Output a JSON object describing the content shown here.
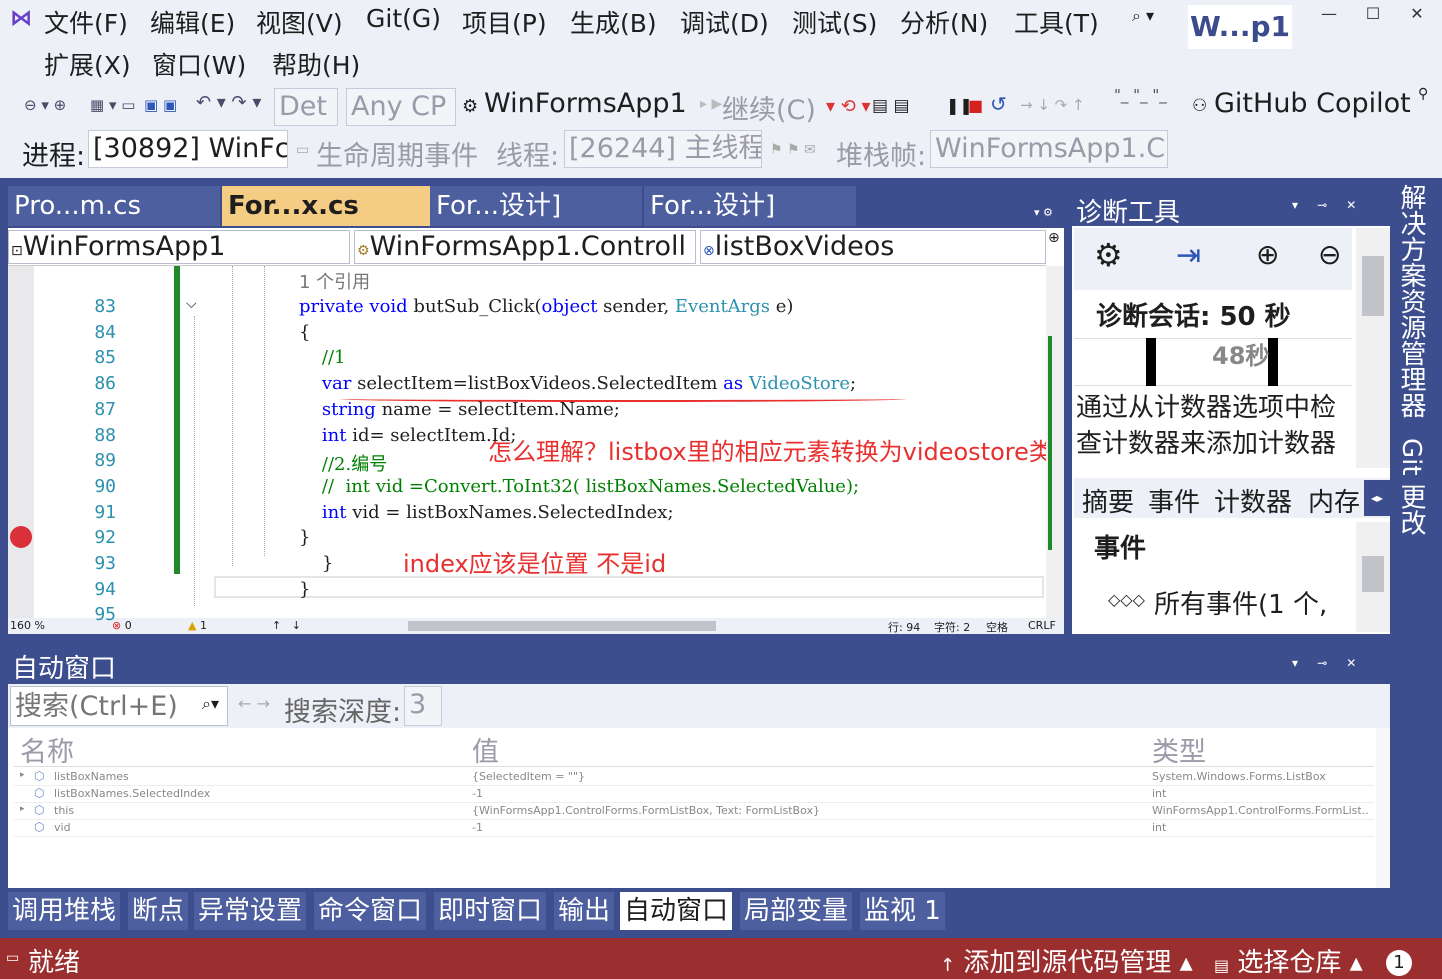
{
  "menu": [
    "文件(F)",
    "编辑(E)",
    "视图(V)",
    "Git(G)",
    "项目(P)",
    "生成(B)",
    "调试(D)",
    "测试(S)",
    "分析(N)",
    "工具(T)",
    "扩展(X)",
    "窗口(W)",
    "帮助(H)"
  ],
  "title_badge": "W...p1",
  "window_controls": {
    "minimize": "—",
    "maximize": "☐",
    "close": "✕"
  },
  "toolbar": {
    "config": "Det",
    "platform": "Any CP",
    "startup_project": "WinFormsApp1",
    "continue": "继续(C)",
    "copilot": "GitHub Copilot"
  },
  "debugbar": {
    "process_label": "进程:",
    "process_value": "[30892] WinFc",
    "lifecycle": "生命周期事件",
    "thread_label": "线程:",
    "thread_value": "[26244] 主线程",
    "stack_label": "堆栈帧:",
    "stack_value": "WinFormsApp1.C"
  },
  "doc_tabs": [
    "Pro...m.cs",
    "For...x.cs",
    "For...设计]",
    "For...设计]"
  ],
  "nav": {
    "project": "WinFormsApp1",
    "class": "WinFormsApp1.Controll",
    "member": "listBoxVideos"
  },
  "code": {
    "refs": "1 个引用",
    "lines": [
      {
        "no": "83",
        "tokens": [
          [
            "kw",
            "private "
          ],
          [
            "kw",
            "void "
          ],
          [
            "pl",
            "butSub_Click("
          ],
          [
            "kw",
            "object "
          ],
          [
            "pl",
            "sender, "
          ],
          [
            "ty",
            "EventArgs "
          ],
          [
            "pl",
            "e)"
          ]
        ]
      },
      {
        "no": "84",
        "tokens": [
          [
            "pl",
            "{"
          ]
        ]
      },
      {
        "no": "85",
        "tokens": [
          [
            "cm",
            "    //1"
          ]
        ]
      },
      {
        "no": "86",
        "tokens": [
          [
            "kw",
            "    var "
          ],
          [
            "pl",
            "selectItem=listBoxVideos.SelectedItem "
          ],
          [
            "kw",
            "as "
          ],
          [
            "ty",
            "VideoStore"
          ],
          [
            "pl",
            ";"
          ]
        ]
      },
      {
        "no": "87",
        "tokens": [
          [
            "kw",
            "    string "
          ],
          [
            "pl",
            "name = selectItem.Name;"
          ]
        ]
      },
      {
        "no": "88",
        "tokens": [
          [
            "kw",
            "    int "
          ],
          [
            "pl",
            "id= selectItem.Id;"
          ]
        ]
      },
      {
        "no": "89",
        "tokens": [
          [
            "cm",
            "    //2.编号"
          ]
        ]
      },
      {
        "no": "90",
        "tokens": [
          [
            "cm",
            "    //  int vid =Convert.ToInt32( listBoxNames.SelectedValue);"
          ]
        ]
      },
      {
        "no": "91",
        "tokens": [
          [
            "kw",
            "    int "
          ],
          [
            "pl",
            "vid = listBoxNames.SelectedIndex;"
          ]
        ]
      },
      {
        "no": "92",
        "tokens": [
          [
            "pl",
            "}"
          ]
        ]
      },
      {
        "no": "93",
        "tokens": [
          [
            "pl",
            "    }"
          ]
        ]
      },
      {
        "no": "94",
        "tokens": [
          [
            "pl",
            "}"
          ]
        ]
      },
      {
        "no": "95",
        "tokens": []
      }
    ]
  },
  "annotations": {
    "question": "怎么理解？listbox里的相应元素转换为videostore类？",
    "note": "index应该是位置 不是id"
  },
  "editor_status": {
    "zoom": "160 %",
    "errors": "0",
    "warnings": "1",
    "line": "行: 94",
    "char": "字符: 2",
    "spaces": "空格",
    "eol": "CRLF"
  },
  "diagnostics": {
    "title": "诊断工具",
    "session": "诊断会话: 50 秒",
    "timeline_label": "48秒",
    "hint": "通过从计数器选项中检查计数器来添加计数器",
    "tabs": [
      "摘要",
      "事件",
      "计数器",
      "内存"
    ],
    "events_header": "事件",
    "all_events": "所有事件(1 个,"
  },
  "autos": {
    "title": "自动窗口",
    "search_placeholder": "搜索(Ctrl+E)",
    "depth_label": "搜索深度:",
    "depth_value": "3",
    "columns": [
      "名称",
      "值",
      "类型"
    ],
    "rows": [
      {
        "name": "listBoxNames",
        "value": "{SelectedItem = \"\"}",
        "type": "System.Windows.Forms.ListBox",
        "expandable": true
      },
      {
        "name": "listBoxNames.SelectedIndex",
        "value": "-1",
        "type": "int",
        "expandable": false
      },
      {
        "name": "this",
        "value": "{WinFormsApp1.ControlForms.FormListBox, Text: FormListBox}",
        "type": "WinFormsApp1.ControlForms.FormList...",
        "expandable": true
      },
      {
        "name": "vid",
        "value": "-1",
        "type": "int",
        "expandable": false
      }
    ]
  },
  "tool_tabs": [
    "调用堆栈",
    "断点",
    "异常设置",
    "命令窗口",
    "即时窗口",
    "输出",
    "自动窗口",
    "局部变量",
    "监视 1"
  ],
  "active_tool_tab": 6,
  "side_strip": [
    "解决方案资源管理器",
    "Git 更改"
  ],
  "statusbar": {
    "ready": "就绪",
    "source_control": "添加到源代码管理",
    "repo": "选择仓库",
    "notifications": "1"
  }
}
